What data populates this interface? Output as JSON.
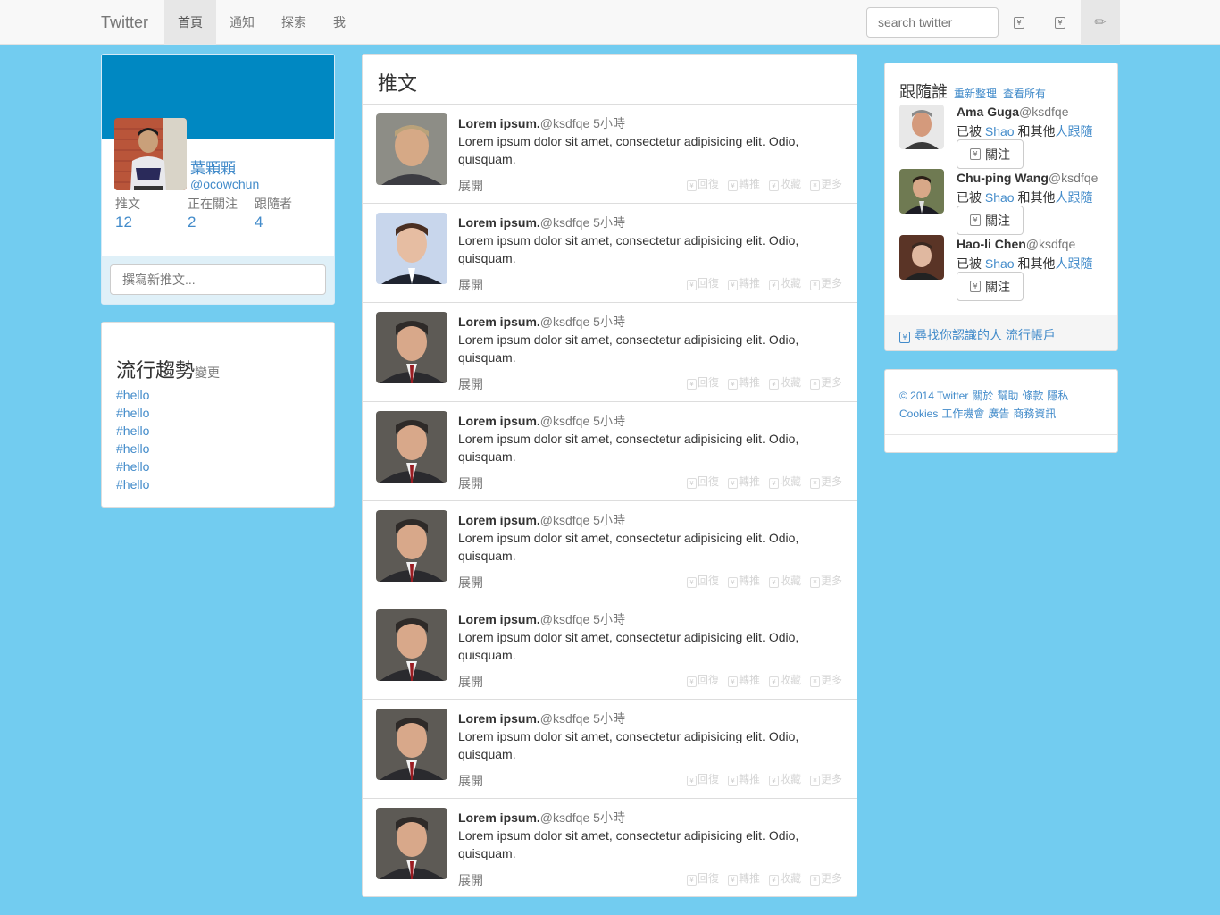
{
  "nav": {
    "brand": "Twitter",
    "items": [
      "首頁",
      "通知",
      "探索",
      "我"
    ],
    "search_placeholder": "search twitter",
    "icons": [
      "envelope-icon",
      "cog-icon",
      "pencil-icon"
    ]
  },
  "profile": {
    "name": "葉顆顆",
    "handle": "@ocowchun",
    "stats": [
      {
        "label": "推文",
        "value": "12"
      },
      {
        "label": "正在關注",
        "value": "2"
      },
      {
        "label": "跟隨者",
        "value": "4"
      }
    ],
    "compose_placeholder": "撰寫新推文..."
  },
  "trends": {
    "title": "流行趨勢",
    "change": "變更",
    "items": [
      "#hello",
      "#hello",
      "#hello",
      "#hello",
      "#hello",
      "#hello"
    ]
  },
  "timeline": {
    "title": "推文",
    "tweets": [
      {
        "name": "Lorem ipsum.",
        "handle": "@ksdfqe",
        "time": "5小時",
        "text": "Lorem ipsum dolor sit amet, consectetur adipisicing elit. Odio, quisquam.",
        "expand": "展開"
      },
      {
        "name": "Lorem ipsum.",
        "handle": "@ksdfqe",
        "time": "5小時",
        "text": "Lorem ipsum dolor sit amet, consectetur adipisicing elit. Odio, quisquam.",
        "expand": "展開"
      },
      {
        "name": "Lorem ipsum.",
        "handle": "@ksdfqe",
        "time": "5小時",
        "text": "Lorem ipsum dolor sit amet, consectetur adipisicing elit. Odio, quisquam.",
        "expand": "展開"
      },
      {
        "name": "Lorem ipsum.",
        "handle": "@ksdfqe",
        "time": "5小時",
        "text": "Lorem ipsum dolor sit amet, consectetur adipisicing elit. Odio, quisquam.",
        "expand": "展開"
      },
      {
        "name": "Lorem ipsum.",
        "handle": "@ksdfqe",
        "time": "5小時",
        "text": "Lorem ipsum dolor sit amet, consectetur adipisicing elit. Odio, quisquam.",
        "expand": "展開"
      },
      {
        "name": "Lorem ipsum.",
        "handle": "@ksdfqe",
        "time": "5小時",
        "text": "Lorem ipsum dolor sit amet, consectetur adipisicing elit. Odio, quisquam.",
        "expand": "展開"
      },
      {
        "name": "Lorem ipsum.",
        "handle": "@ksdfqe",
        "time": "5小時",
        "text": "Lorem ipsum dolor sit amet, consectetur adipisicing elit. Odio, quisquam.",
        "expand": "展開"
      },
      {
        "name": "Lorem ipsum.",
        "handle": "@ksdfqe",
        "time": "5小時",
        "text": "Lorem ipsum dolor sit amet, consectetur adipisicing elit. Odio, quisquam.",
        "expand": "展開"
      }
    ],
    "actions": [
      "回復",
      "轉推",
      "收藏",
      "更多"
    ]
  },
  "follow": {
    "title": "跟隨誰",
    "refresh": "重新整理",
    "view_all": "查看所有",
    "users": [
      {
        "name": "Ama Guga",
        "handle": "@ksdfqe",
        "pre": "已被",
        "by": "Shao",
        "mid": "和其他",
        "link": "人跟隨",
        "button": "關注"
      },
      {
        "name": "Chu-ping Wang",
        "handle": "@ksdfqe",
        "pre": "已被",
        "by": "Shao",
        "mid": "和其他",
        "link": "人跟隨",
        "button": "關注"
      },
      {
        "name": "Hao-li Chen",
        "handle": "@ksdfqe",
        "pre": "已被",
        "by": "Shao",
        "mid": "和其他",
        "link": "人跟隨",
        "button": "關注"
      }
    ],
    "find_people": "尋找你認識的人",
    "popular": "流行帳戶"
  },
  "footer": {
    "line1": [
      "© 2014 Twitter",
      "關於",
      "幫助",
      "條款",
      "隱私"
    ],
    "line2": [
      "Cookies",
      "工作機會",
      "廣告",
      "商務資訊"
    ]
  }
}
